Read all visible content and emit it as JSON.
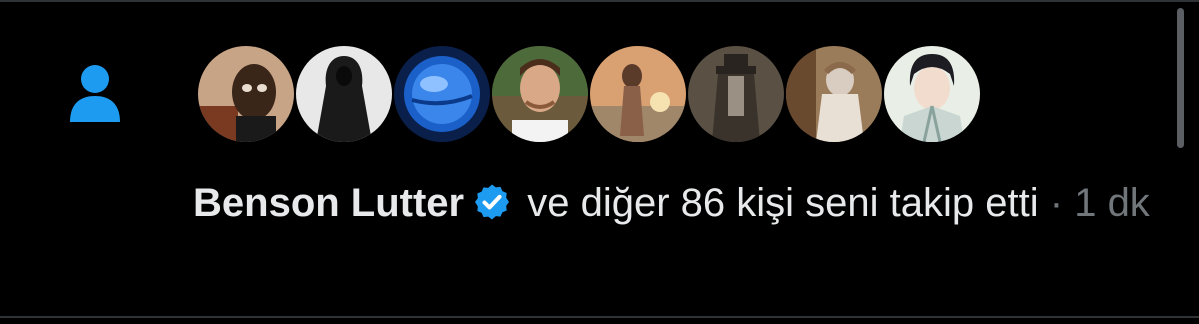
{
  "notification": {
    "icon": "person-icon",
    "user_name": "Benson Lutter",
    "verified_icon": "verified-badge-icon",
    "message_rest": "ve diğer 86 kişi seni takip etti",
    "separator": "·",
    "timestamp": "1 dk",
    "avatars": [
      {
        "name": "avatar-1"
      },
      {
        "name": "avatar-2"
      },
      {
        "name": "avatar-3"
      },
      {
        "name": "avatar-4"
      },
      {
        "name": "avatar-5"
      },
      {
        "name": "avatar-6"
      },
      {
        "name": "avatar-7"
      },
      {
        "name": "avatar-8"
      }
    ]
  },
  "colors": {
    "background": "#000000",
    "text_primary": "#e7e9ea",
    "text_secondary": "#71767b",
    "accent": "#1d9bf0"
  }
}
